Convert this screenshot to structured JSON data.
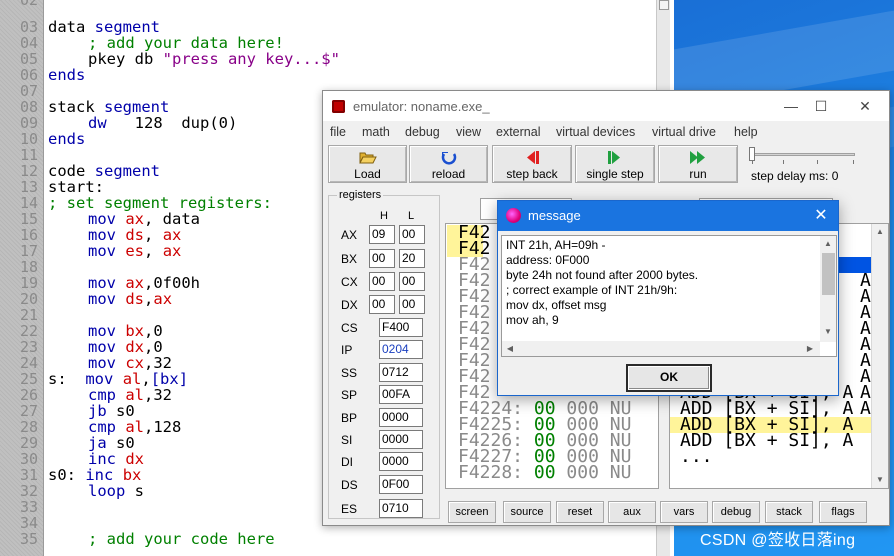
{
  "editor": {
    "line_numbers": [
      "02",
      "03",
      "04",
      "05",
      "06",
      "07",
      "08",
      "09",
      "10",
      "11",
      "12",
      "13",
      "14",
      "15",
      "16",
      "17",
      "18",
      "19",
      "20",
      "21",
      "22",
      "23",
      "24",
      "25",
      "26",
      "27",
      "28",
      "29",
      "30",
      "31",
      "32",
      "33",
      "34",
      "35"
    ],
    "code": {
      "l03": [
        "data",
        "segment"
      ],
      "l04": "; add your data here!",
      "l05": [
        "pkey db ",
        "\"press any key...$\""
      ],
      "l06": "ends",
      "l08": [
        "stack",
        "segment"
      ],
      "l09": [
        "dw",
        "128",
        "dup(0)"
      ],
      "l10": "ends",
      "l12": [
        "code",
        "segment"
      ],
      "l13": "start:",
      "l14": "; set segment registers:",
      "l15": [
        "mov",
        "ax",
        ", data"
      ],
      "l16": [
        "mov",
        "ds",
        ",",
        "ax"
      ],
      "l17": [
        "mov",
        "es",
        ",",
        "ax"
      ],
      "l19": [
        "mov",
        "ax",
        ",0f00h"
      ],
      "l20": [
        "mov",
        "ds",
        ",",
        "ax"
      ],
      "l22": [
        "mov",
        "bx",
        ",0"
      ],
      "l23": [
        "mov",
        "dx",
        ",0"
      ],
      "l24": [
        "mov",
        "cx",
        ",32"
      ],
      "l25": [
        "s:",
        "mov",
        "al",
        ",",
        "[bx]"
      ],
      "l26": [
        "cmp",
        "al",
        ",32"
      ],
      "l27": [
        "jb",
        "s0"
      ],
      "l28": [
        "cmp",
        "al",
        ",128"
      ],
      "l29": [
        "ja",
        "s0"
      ],
      "l30": [
        "inc",
        "dx"
      ],
      "l31": [
        "s0:",
        "inc",
        "bx"
      ],
      "l32": [
        "loop",
        "s"
      ],
      "l35": "; add your code here"
    }
  },
  "emulator": {
    "title": "emulator: noname.exe_",
    "menu": [
      "file",
      "math",
      "debug",
      "view",
      "external",
      "virtual devices",
      "virtual drive",
      "help"
    ],
    "toolbar": {
      "load": "Load",
      "reload": "reload",
      "step_back": "step back",
      "single_step": "single step",
      "run": "run",
      "step_delay": "step delay ms: 0"
    },
    "registers_title": "registers",
    "reg_h_label": "H",
    "reg_l_label": "L",
    "gp_registers": [
      {
        "name": "AX",
        "h": "09",
        "l": "00"
      },
      {
        "name": "BX",
        "h": "00",
        "l": "20"
      },
      {
        "name": "CX",
        "h": "00",
        "l": "00"
      },
      {
        "name": "DX",
        "h": "00",
        "l": "00"
      }
    ],
    "seg_registers": [
      {
        "name": "CS",
        "value": "F400"
      },
      {
        "name": "IP",
        "value": "0204"
      },
      {
        "name": "SS",
        "value": "0712"
      },
      {
        "name": "SP",
        "value": "00FA"
      },
      {
        "name": "BP",
        "value": "0000"
      },
      {
        "name": "SI",
        "value": "0000"
      },
      {
        "name": "DI",
        "value": "0000"
      },
      {
        "name": "DS",
        "value": "0F00"
      },
      {
        "name": "ES",
        "value": "0710"
      }
    ],
    "memory_partial": [
      "F42",
      "F42",
      "F42",
      "F42",
      "F42",
      "F42",
      "F42",
      "F42",
      "F42",
      "F42",
      "F42"
    ],
    "memory_rows": [
      {
        "addr": "F4224:",
        "hex": "00",
        "dec": "000",
        "ch": "NU"
      },
      {
        "addr": "F4225:",
        "hex": "00",
        "dec": "000",
        "ch": "NU"
      },
      {
        "addr": "F4226:",
        "hex": "00",
        "dec": "000",
        "ch": "NU"
      },
      {
        "addr": "F4227:",
        "hex": "00",
        "dec": "000",
        "ch": "NU"
      },
      {
        "addr": "F4228:",
        "hex": "00",
        "dec": "000",
        "ch": "NU"
      }
    ],
    "dis_partial": [
      "A",
      "A",
      "A",
      "A",
      "A",
      "A",
      "A",
      "A",
      "A"
    ],
    "dis_rows": [
      "ADD [BX + SI], A",
      "ADD [BX + SI], A",
      "ADD [BX + SI], A",
      "ADD [BX + SI], A",
      "..."
    ],
    "bottom_buttons": [
      "screen",
      "source",
      "reset",
      "aux",
      "vars",
      "debug",
      "stack",
      "flags"
    ]
  },
  "message": {
    "title": "message",
    "lines": [
      "INT 21h, AH=09h -",
      "address: 0F000",
      "byte 24h not found after 2000 bytes.",
      "; correct example of INT 21h/9h:",
      "mov dx, offset msg",
      "mov ah, 9"
    ],
    "ok_label": "OK"
  },
  "watermark": "CSDN @签收日落ing",
  "colors": {
    "keyword": "#0000aa",
    "register": "#cc0000",
    "comment": "#008000",
    "highlight": "#fff49a",
    "dialog_title": "#1a74e0"
  }
}
